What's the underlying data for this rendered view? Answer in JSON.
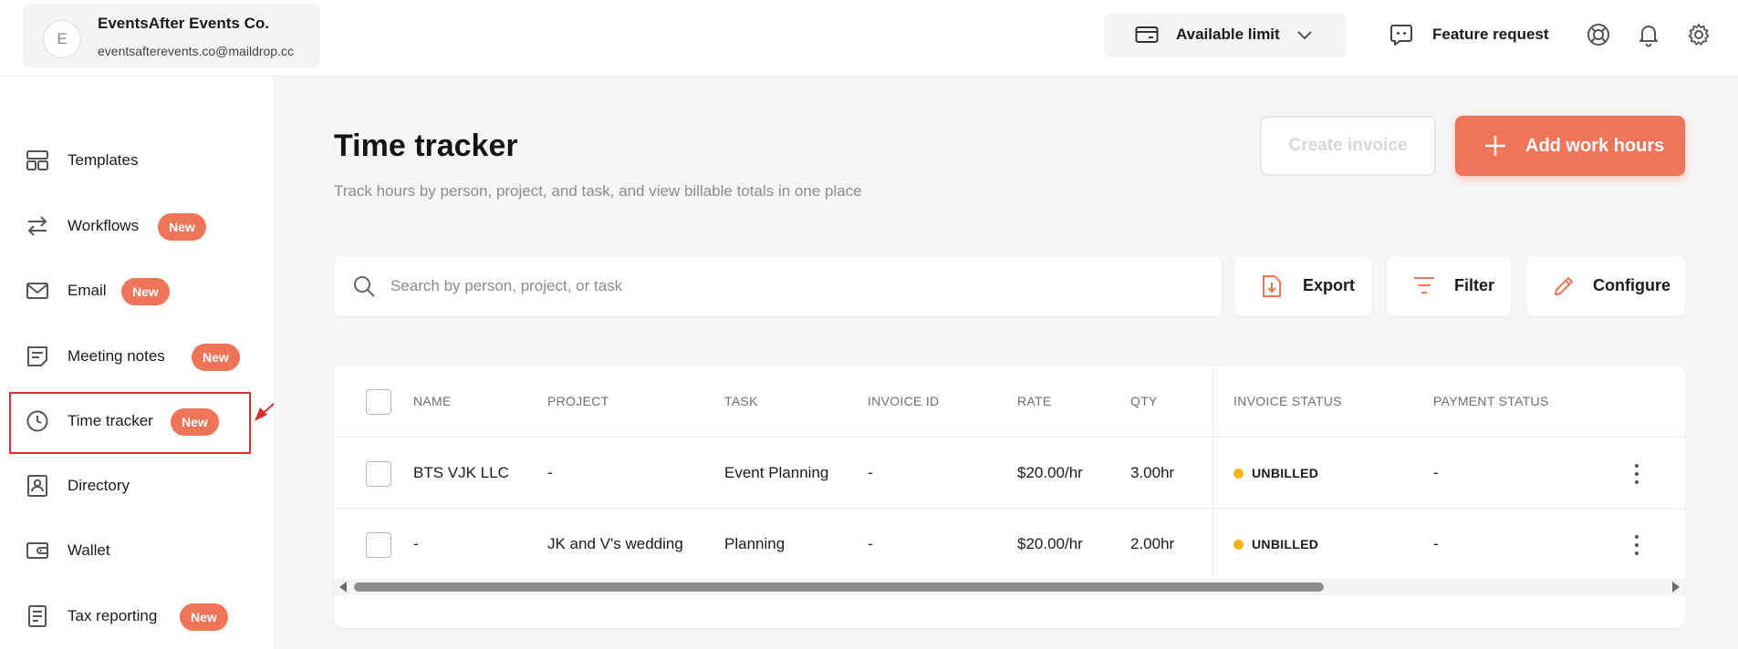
{
  "account": {
    "avatar_initial": "E",
    "name": "EventsAfter Events Co.",
    "email": "eventsafterevents.co@maildrop.cc"
  },
  "header": {
    "available_limit_label": "Available limit",
    "feature_request_label": "Feature request",
    "icons": [
      "credit-card-icon",
      "chevron-down-icon",
      "chat-icon",
      "lifebuoy-icon",
      "bell-icon",
      "gear-icon"
    ]
  },
  "sidebar": {
    "badge_text": "New",
    "items": [
      {
        "label": "Templates",
        "icon": "templates-icon",
        "badge": false
      },
      {
        "label": "Workflows",
        "icon": "arrows-icon",
        "badge": true
      },
      {
        "label": "Email",
        "icon": "mail-icon",
        "badge": true
      },
      {
        "label": "Meeting notes",
        "icon": "notes-icon",
        "badge": true
      },
      {
        "label": "Time tracker",
        "icon": "clock-icon",
        "badge": true
      },
      {
        "label": "Directory",
        "icon": "contact-icon",
        "badge": false
      },
      {
        "label": "Wallet",
        "icon": "wallet-icon",
        "badge": false
      },
      {
        "label": "Tax reporting",
        "icon": "document-icon",
        "badge": true
      }
    ]
  },
  "page": {
    "title": "Time tracker",
    "subtitle": "Track hours by person, project, and task, and view billable totals in one place",
    "create_invoice_label": "Create invoice",
    "add_work_hours_label": "Add work hours"
  },
  "toolbar": {
    "search_placeholder": "Search by person, project, or task",
    "export_label": "Export",
    "filter_label": "Filter",
    "configure_label": "Configure"
  },
  "table": {
    "columns": [
      "NAME",
      "PROJECT",
      "TASK",
      "INVOICE ID",
      "RATE",
      "QTY",
      "INVOICE STATUS",
      "PAYMENT STATUS"
    ],
    "rows": [
      {
        "name": "BTS VJK LLC",
        "project": "-",
        "task": "Event Planning",
        "invoice_id": "-",
        "rate": "$20.00/hr",
        "qty": "3.00hr",
        "invoice_status": "UNBILLED",
        "payment_status": "-"
      },
      {
        "name": "-",
        "project": "JK and V's wedding",
        "task": "Planning",
        "invoice_id": "-",
        "rate": "$20.00/hr",
        "qty": "2.00hr",
        "invoice_status": "UNBILLED",
        "payment_status": "-"
      }
    ]
  },
  "colors": {
    "accent": "#f07457",
    "unbilled_dot": "#f5b419",
    "annotation": "#d92e32"
  }
}
